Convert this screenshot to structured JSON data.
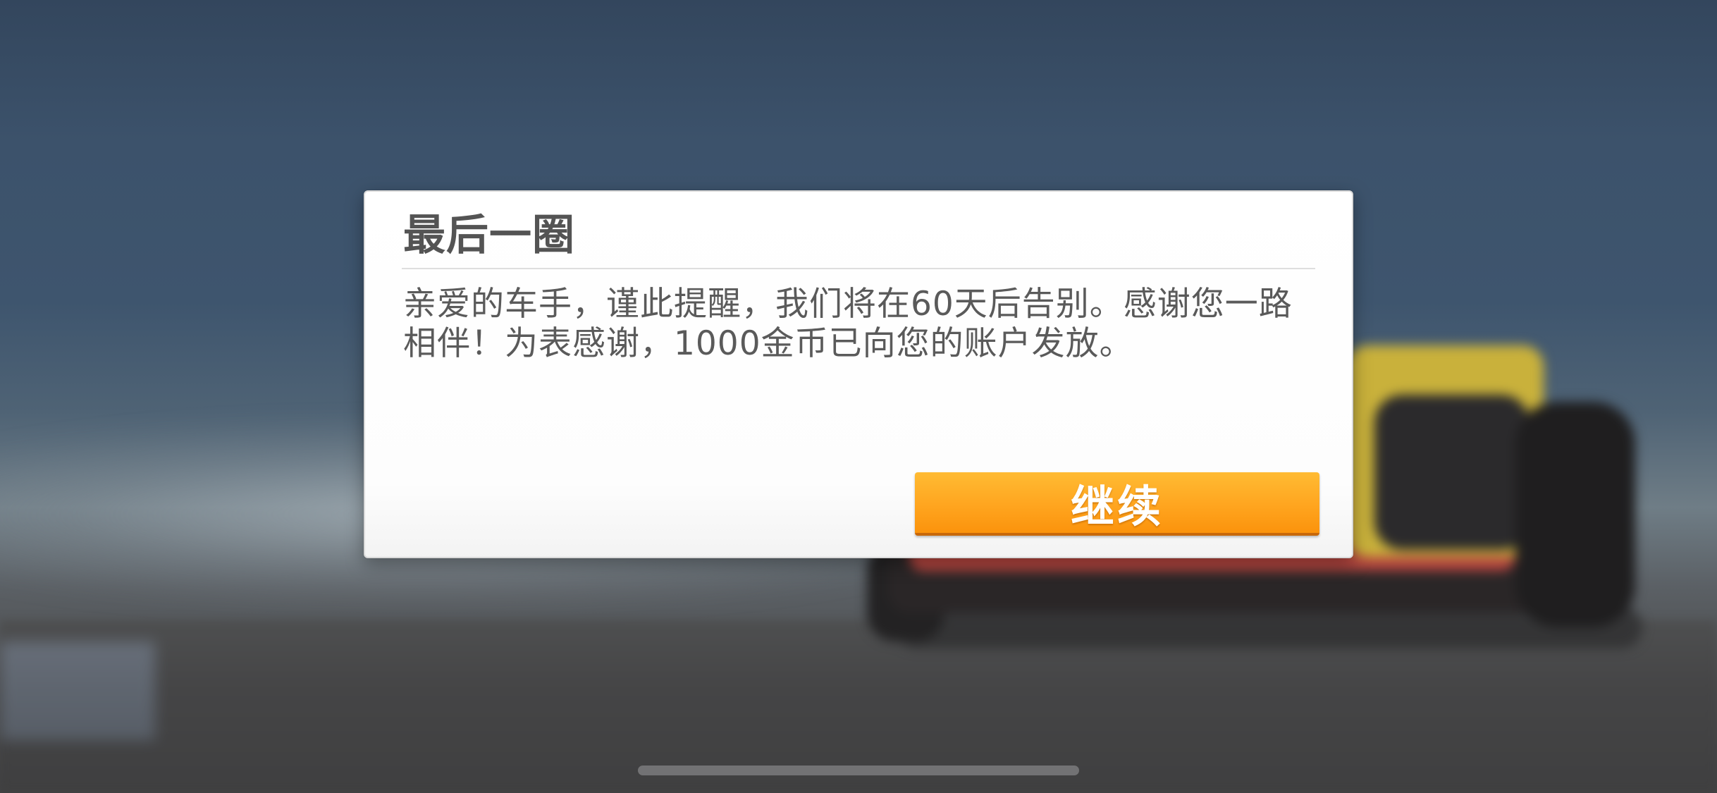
{
  "dialog": {
    "title": "最后一圈",
    "message_line1": "亲爱的车手，谨此提醒，我们将在60天后告别。感谢您一路",
    "message_line2": "相伴！为表感谢，1000金币已向您的账户发放。",
    "continue_label": "继续"
  },
  "colors": {
    "button_accent": "#ffa51f",
    "title_text": "#545454",
    "dialog_background": "#ffffff"
  }
}
